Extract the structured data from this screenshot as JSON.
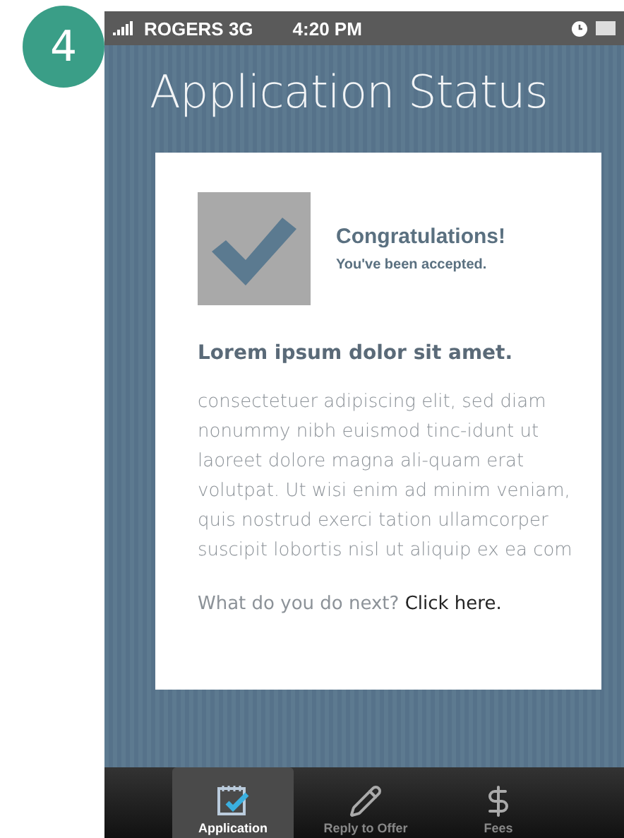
{
  "step_badge": "4",
  "status_bar": {
    "carrier": "ROGERS 3G",
    "time": "4:20 PM"
  },
  "title": "Application Status",
  "card": {
    "heading": "Congratulations!",
    "subheading": "You've been accepted.",
    "section_title": "Lorem ipsum dolor sit amet.",
    "body": "consectetuer adipiscing elit, sed diam nonummy nibh euismod tinc-idunt ut laoreet dolore magna ali-quam erat volutpat. Ut wisi enim ad minim veniam, quis nostrud exerci tation ullamcorper suscipit lobortis nisl ut aliquip ex ea com",
    "prompt": "What do you do next?",
    "link": "Click here."
  },
  "tabs": [
    {
      "label": "Application",
      "kind": "notepad",
      "selected": true
    },
    {
      "label": "Reply to Offer",
      "kind": "pencil",
      "selected": false
    },
    {
      "label": "Fees",
      "kind": "dollar",
      "selected": false
    }
  ]
}
